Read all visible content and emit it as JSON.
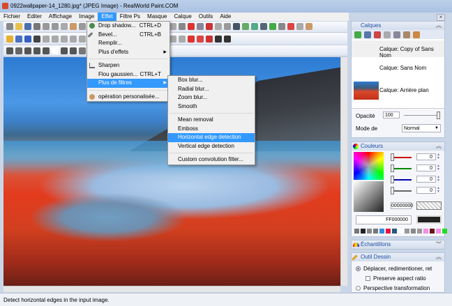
{
  "window": {
    "title": "0922wallpaper-14_1280.jpg* (JPEG Image) - RealWorld Paint.COM",
    "close": "×"
  },
  "menubar": [
    "Fichier",
    "Editer",
    "Affichage",
    "Image",
    "Effet",
    "Filtre Ps",
    "Masque",
    "Calque",
    "Outils",
    "Aide"
  ],
  "effet_menu": [
    {
      "label": "Drop shadow...",
      "shortcut": "CTRL+D"
    },
    {
      "label": "Bevel...",
      "shortcut": "CTRL+B"
    },
    {
      "label": "Remplir..."
    },
    {
      "label": "Plus d'effets",
      "submenu": "▶"
    },
    {
      "label": "Sharpen"
    },
    {
      "label": "Flou gaussien...",
      "shortcut": "CTRL+T"
    },
    {
      "label": "Plus de filtres",
      "submenu": "▶"
    },
    {
      "label": "opération personalisée..."
    }
  ],
  "submenu": [
    "Box blur...",
    "Radial blur...",
    "Zoom blur...",
    "Smooth",
    "Mean removal",
    "Emboss",
    "Horizontal edge detection",
    "Vertical edge detection",
    "Custom convolution filter..."
  ],
  "layers": {
    "title": "Calques",
    "items": [
      "Calque: Copy of Sans Nom",
      "Calque: Sans Nom",
      "Calque: Arrière plan"
    ],
    "opacity_label": "Opacité",
    "opacity": "100",
    "opacity_level": 1.0,
    "mode_label": "Mode de",
    "mode": "Normal"
  },
  "colors": {
    "title": "Couleurs",
    "channels": [
      "0",
      "0",
      "0",
      "0"
    ],
    "secondary_hex": "00000000",
    "primary_hex": "FF000000",
    "palette": [
      "#777",
      "#222",
      "#888",
      "#777",
      "#2f8be0",
      "#e8143c",
      "#245c7a",
      "#fff",
      "#999",
      "#888",
      "#999",
      "#f58ee0",
      "#6b1020",
      "#f58ee0",
      "#22dd22"
    ]
  },
  "samples": {
    "title": "Échantillons"
  },
  "tool": {
    "title": "Outil Dessin",
    "option1": "Déplacer, redimentioner, ret",
    "checkbox": "Preserve aspect ratio",
    "option2": "Perspective transformation"
  },
  "status": "Detect horizontal edges in the input image."
}
